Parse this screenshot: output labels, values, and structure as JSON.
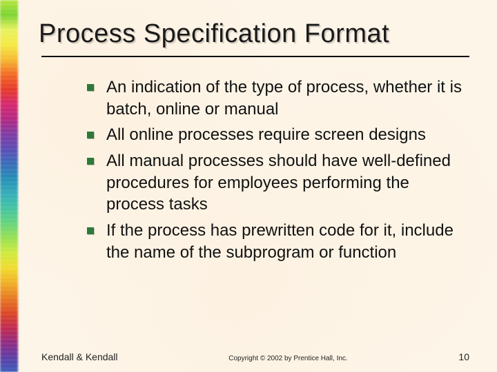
{
  "title": "Process Specification Format",
  "bullets": [
    "An indication of the type of process, whether it is batch, online or manual",
    "All online processes require screen designs",
    "All manual processes should have well-defined procedures for employees performing the process tasks",
    "If the process has prewritten code for it, include the name of the subprogram or function"
  ],
  "footer": {
    "author": "Kendall & Kendall",
    "copyright": "Copyright © 2002 by Prentice Hall, Inc.",
    "page": "10"
  }
}
